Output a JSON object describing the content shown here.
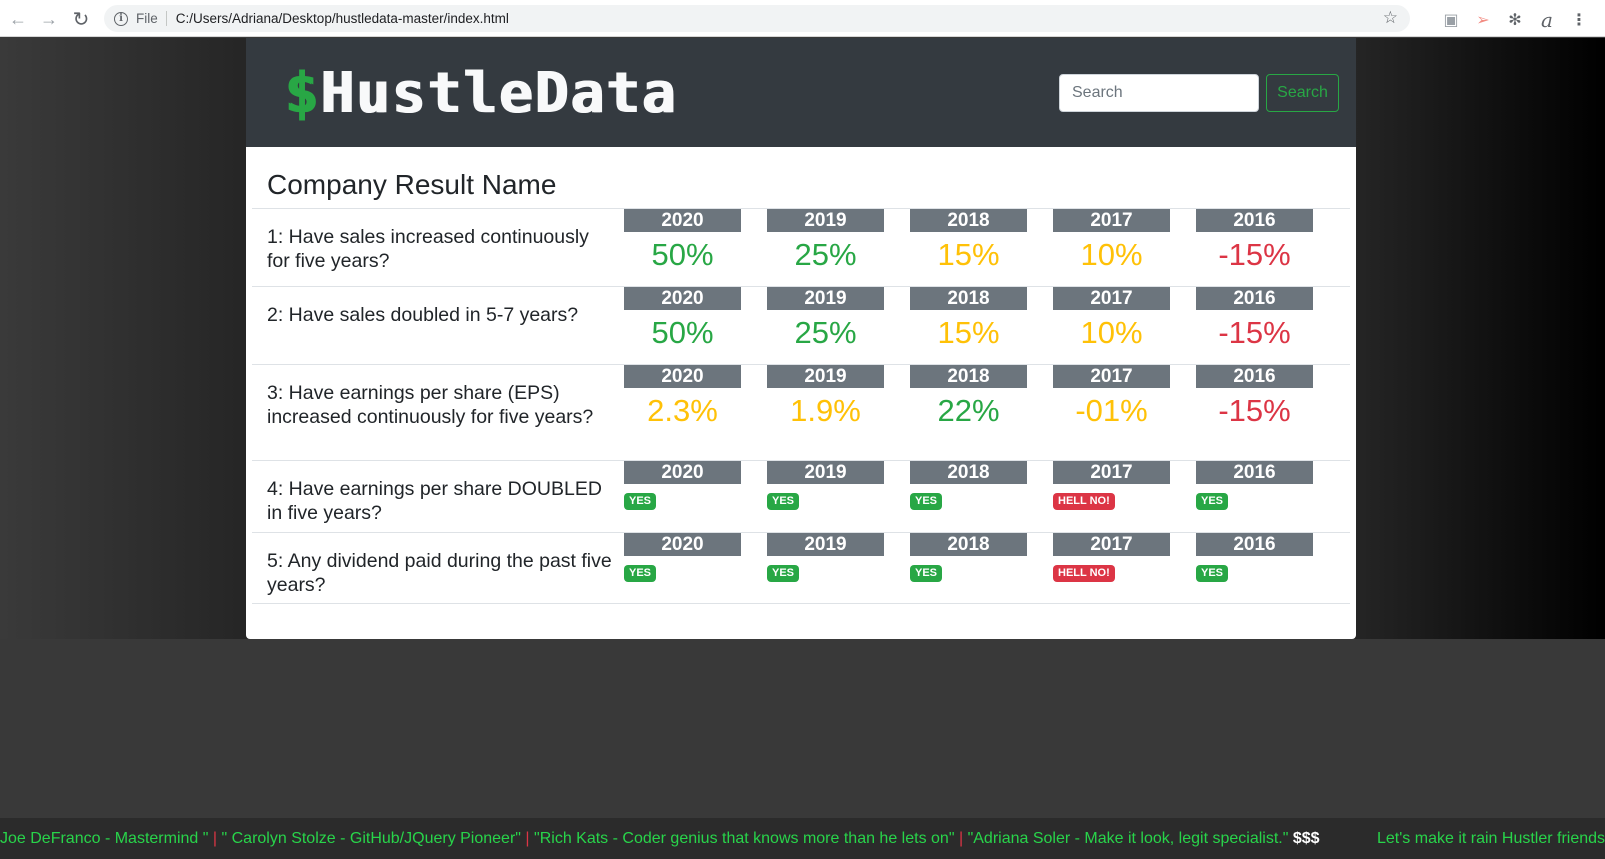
{
  "browser": {
    "file_label": "File",
    "url": "C:/Users/Adriana/Desktop/hustledata-master/index.html"
  },
  "navbar": {
    "brand_symbol": "$",
    "brand_text": "HustleData",
    "search_placeholder": "Search",
    "search_button": "Search"
  },
  "card": {
    "title": "Company Result Name",
    "questions": [
      {
        "text": "1: Have sales increased continuously for five years?",
        "years": [
          {
            "year": "2020",
            "value": "50%",
            "color": "green"
          },
          {
            "year": "2019",
            "value": "25%",
            "color": "green"
          },
          {
            "year": "2018",
            "value": "15%",
            "color": "yellow"
          },
          {
            "year": "2017",
            "value": "10%",
            "color": "yellow"
          },
          {
            "year": "2016",
            "value": "-15%",
            "color": "red"
          }
        ]
      },
      {
        "text": "2: Have sales doubled in 5-7 years?",
        "years": [
          {
            "year": "2020",
            "value": "50%",
            "color": "green"
          },
          {
            "year": "2019",
            "value": "25%",
            "color": "green"
          },
          {
            "year": "2018",
            "value": "15%",
            "color": "yellow"
          },
          {
            "year": "2017",
            "value": "10%",
            "color": "yellow"
          },
          {
            "year": "2016",
            "value": "-15%",
            "color": "red"
          }
        ]
      },
      {
        "text": "3: Have earnings per share (EPS) increased continuously for five years?",
        "years": [
          {
            "year": "2020",
            "value": "2.3%",
            "color": "yellow"
          },
          {
            "year": "2019",
            "value": "1.9%",
            "color": "yellow"
          },
          {
            "year": "2018",
            "value": "22%",
            "color": "green"
          },
          {
            "year": "2017",
            "value": "-01%",
            "color": "yellow"
          },
          {
            "year": "2016",
            "value": "-15%",
            "color": "red"
          }
        ]
      },
      {
        "text": "4: Have earnings per share DOUBLED in five years?",
        "years": [
          {
            "year": "2020",
            "badge": "YES",
            "color": "green"
          },
          {
            "year": "2019",
            "badge": "YES",
            "color": "green"
          },
          {
            "year": "2018",
            "badge": "YES",
            "color": "green"
          },
          {
            "year": "2017",
            "badge": "HELL NO!",
            "color": "red"
          },
          {
            "year": "2016",
            "badge": "YES",
            "color": "green"
          }
        ]
      },
      {
        "text": "5: Any dividend paid during the past five years?",
        "years": [
          {
            "year": "2020",
            "badge": "YES",
            "color": "green"
          },
          {
            "year": "2019",
            "badge": "YES",
            "color": "green"
          },
          {
            "year": "2018",
            "badge": "YES",
            "color": "green"
          },
          {
            "year": "2017",
            "badge": "HELL NO!",
            "color": "red"
          },
          {
            "year": "2016",
            "badge": "YES",
            "color": "green"
          }
        ]
      }
    ]
  },
  "ticker": {
    "items": [
      "Joe DeFranco - Mastermind \"",
      "\" Carolyn Stolze - GitHub/JQuery Pioneer\"",
      "\"Rich Kats - Coder genius that knows more than he lets on\"",
      "\"Adriana Soler - Make it look, legit specialist.\""
    ],
    "separator": "|",
    "dollars": "$$$",
    "closing": "Let's make it rain Hustler friends!"
  },
  "colors": {
    "green": "#28a745",
    "yellow": "#ffc107",
    "red": "#dc3545",
    "year_header": "#6c757d",
    "navbar": "#343a40"
  }
}
